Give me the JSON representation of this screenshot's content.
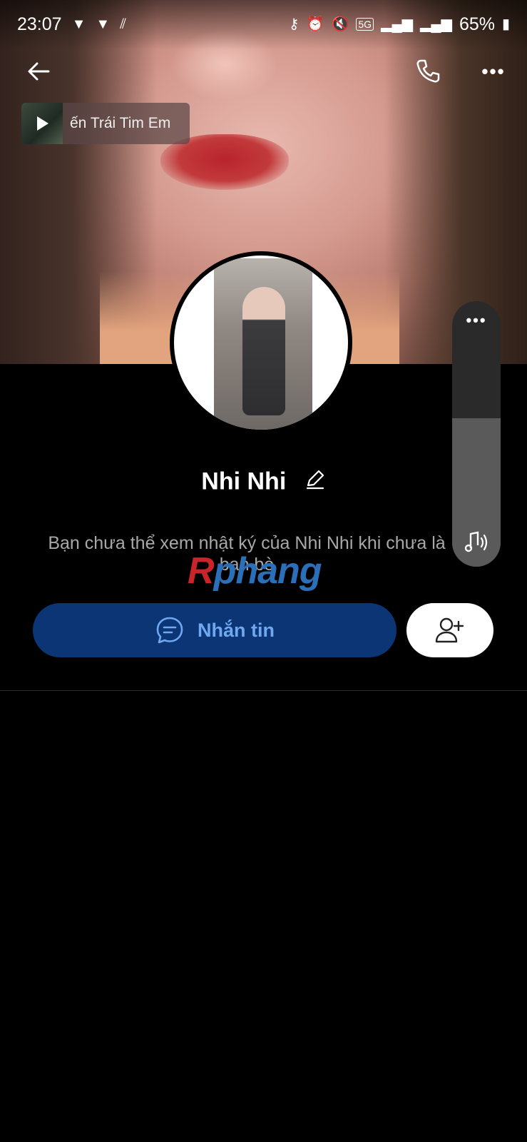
{
  "status_bar": {
    "time": "23:07",
    "network": "5G",
    "battery": "65%"
  },
  "top_bar": {
    "icons": [
      "back-arrow-icon",
      "phone-icon",
      "more-icon"
    ]
  },
  "music": {
    "title": "ến Trái Tim Em"
  },
  "profile": {
    "name": "Nhi Nhi",
    "privacy_note": "Bạn chưa thể xem nhật ký của Nhi Nhi khi chưa là bạn bè"
  },
  "watermark": {
    "part1": "R",
    "part2": "phang"
  },
  "actions": {
    "message_label": "Nhắn tin"
  },
  "volume": {
    "level": 0.56
  },
  "colors": {
    "background": "#000000",
    "message_button_bg": "#0b3575",
    "message_button_text": "#6fa8f0",
    "watermark_red": "#c8242a",
    "watermark_blue": "#2a6fb8"
  }
}
